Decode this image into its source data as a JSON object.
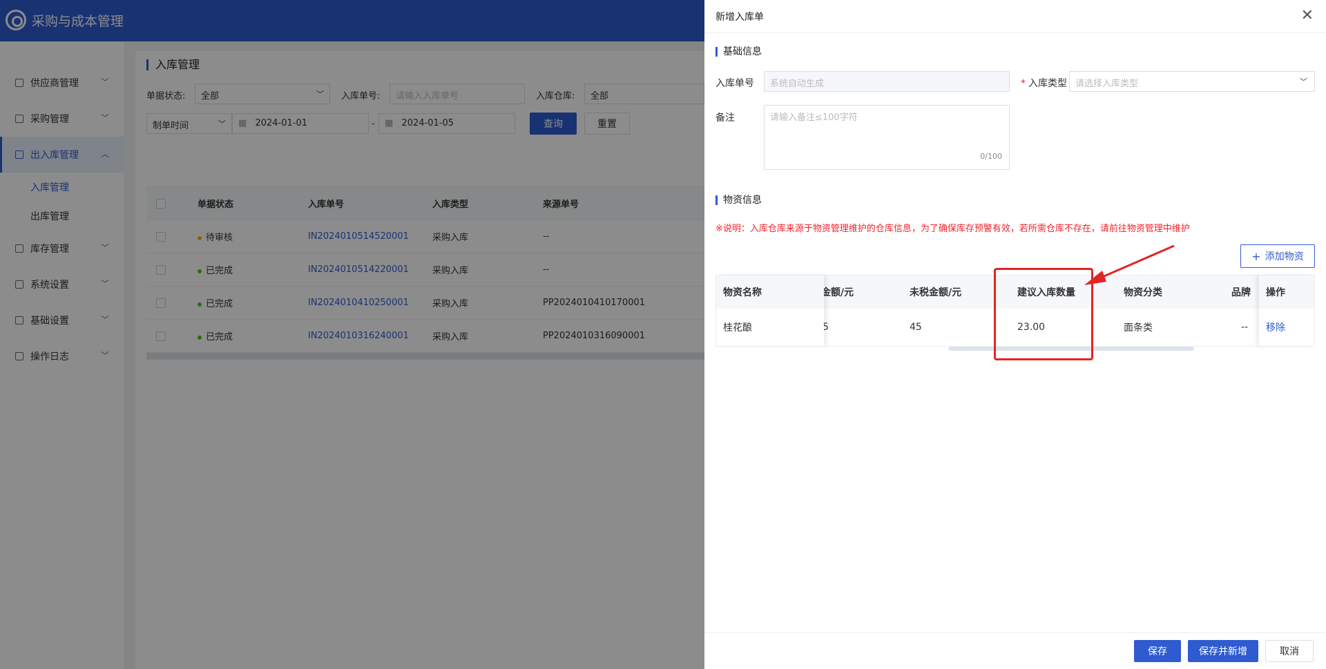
{
  "app": {
    "title": "采购与成本管理"
  },
  "sidebar": {
    "items": [
      {
        "label": "供应商管理"
      },
      {
        "label": "采购管理"
      },
      {
        "label": "出入库管理"
      },
      {
        "label": "库存管理"
      },
      {
        "label": "系统设置"
      },
      {
        "label": "基础设置"
      },
      {
        "label": "操作日志"
      }
    ],
    "sub_items": [
      {
        "label": "入库管理"
      },
      {
        "label": "出库管理"
      }
    ]
  },
  "page": {
    "title": "入库管理",
    "filters": {
      "status_label": "单据状态:",
      "status_value": "全部",
      "number_label": "入库单号:",
      "number_placeholder": "请输入入库单号",
      "warehouse_label": "入库仓库:",
      "warehouse_value": "全部",
      "date_type": "制单时间",
      "date_start": "2024-01-01",
      "date_sep": "-",
      "date_end": "2024-01-05",
      "search": "查询",
      "reset": "重置"
    },
    "table": {
      "headers": [
        "单据状态",
        "入库单号",
        "入库类型",
        "来源单号"
      ],
      "rows": [
        {
          "status": "待审核",
          "number": "IN2024010514520001",
          "type": "采购入库",
          "source": "--"
        },
        {
          "status": "已完成",
          "number": "IN2024010514220001",
          "type": "采购入库",
          "source": "--"
        },
        {
          "status": "已完成",
          "number": "IN2024010410250001",
          "type": "采购入库",
          "source": "PP2024010410170001"
        },
        {
          "status": "已完成",
          "number": "IN2024010316240001",
          "type": "采购入库",
          "source": "PP2024010316090001"
        }
      ]
    }
  },
  "drawer": {
    "title": "新增入库单",
    "basic_section": "基础信息",
    "number_label": "入库单号",
    "number_placeholder": "系统自动生成",
    "type_label": "入库类型",
    "type_placeholder": "请选择入库类型",
    "remark_label": "备注",
    "remark_placeholder": "请输入备注≤100字符",
    "remark_count": "0/100",
    "material_section": "物资信息",
    "notice": "※说明：入库仓库来源于物资管理维护的仓库信息，为了确保库存预警有效，若所需仓库不存在，请前往物资管理中维护",
    "add_button": "添加物资",
    "table": {
      "headers": {
        "name": "物资名称",
        "amount": "金额/元",
        "untaxed": "未税金额/元",
        "suggest": "建议入库数量",
        "category": "物资分类",
        "brand": "品牌",
        "action": "操作"
      },
      "row": {
        "name": "桂花酿",
        "amount": "5",
        "untaxed": "45",
        "suggest": "23.00",
        "category": "面条类",
        "brand": "--",
        "action": "移除"
      }
    },
    "footer": {
      "save": "保存",
      "save_new": "保存并新增",
      "cancel": "取消"
    }
  },
  "colors": {
    "primary": "#2f5bd0",
    "danger": "#f5222d",
    "highlight": "#e42323"
  }
}
